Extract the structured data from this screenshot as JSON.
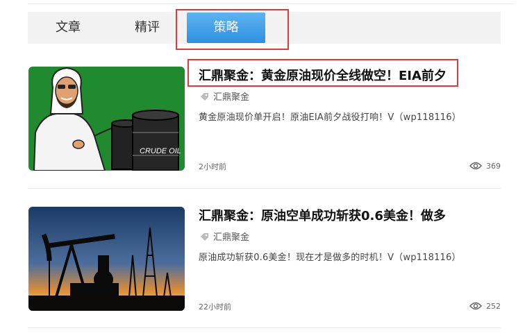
{
  "tabs": [
    {
      "label": "文章"
    },
    {
      "label": "精评"
    },
    {
      "label": "策略"
    }
  ],
  "articles": [
    {
      "title": "汇鼎聚金：黄金原油现价全线做空！EIA前夕",
      "source": "汇鼎聚金",
      "summary": "黄金原油现价单开启！原油EIA前夕战役打响！V（wp118116）",
      "time": "2小时前",
      "views": "369",
      "barrel_text": "CRUDE OIL"
    },
    {
      "title": "汇鼎聚金：原油空单成功斩获0.6美金！做多",
      "source": "汇鼎聚金",
      "summary": "原油成功斩获0.6美金！现在才是做多的时机！V（wp118116）",
      "time": "22小时前",
      "views": "252"
    }
  ],
  "colors": {
    "active_tab": "#2f8fe0",
    "highlight": "#e03a3a",
    "thumb1_bg": "#1f8a2e"
  }
}
